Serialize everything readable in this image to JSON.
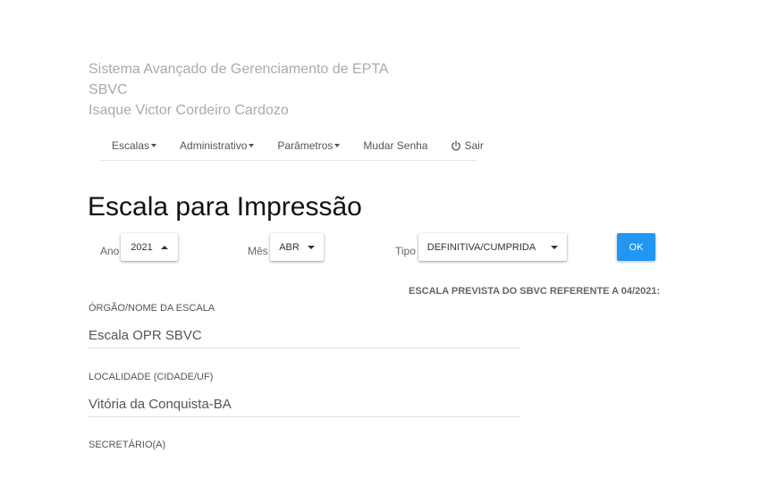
{
  "header": {
    "system_name": "Sistema Avançado de Gerenciamento de EPTA",
    "site": "SBVC",
    "user": "Isaque Victor Cordeiro Cardozo"
  },
  "nav": {
    "escalas": "Escalas",
    "administrativo": "Administrativo",
    "parametros": "Parâmetros",
    "mudar_senha": "Mudar Senha",
    "sair": "Sair"
  },
  "page_title": "Escala para Impressão",
  "filters": {
    "ano_label": "Ano",
    "ano_value": "2021",
    "mes_label": "Mês",
    "mes_value": "ABR",
    "tipo_label": "Tipo",
    "tipo_value": "DEFINITIVA/CUMPRIDA",
    "ok_label": "OK"
  },
  "report": {
    "title": "ESCALA PREVISTA DO SBVC REFERENTE A 04/2021:",
    "orgao_label": "ÓRGÃO/NOME DA ESCALA",
    "orgao_value": "Escala OPR SBVC",
    "localidade_label": "LOCALIDADE (CIDADE/UF)",
    "localidade_value": "Vitória da Conquista-BA",
    "secretario_label": "SECRETÁRIO(A)"
  },
  "colors": {
    "primary": "#2196f3",
    "header_text": "#aaaaaa",
    "title_text": "#111111"
  },
  "icons": {
    "sair": "power-icon"
  }
}
